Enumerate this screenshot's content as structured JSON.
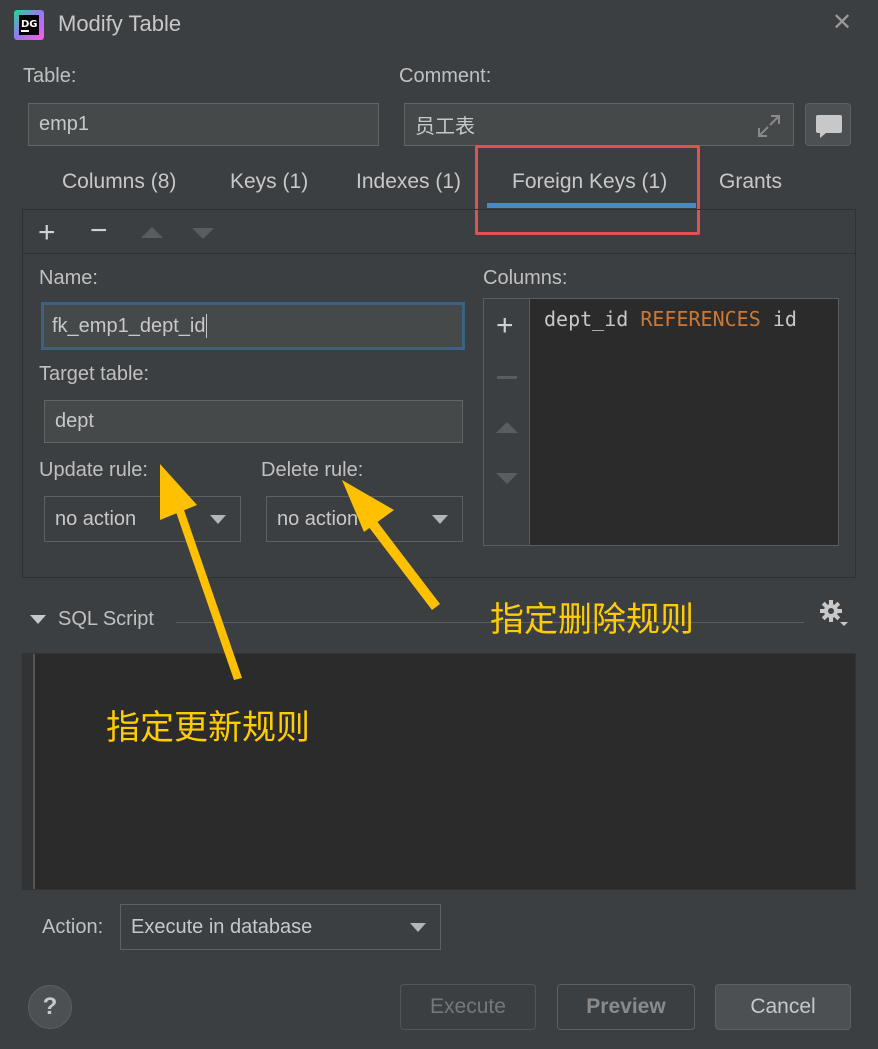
{
  "window": {
    "title": "Modify Table",
    "app_icon_text": "DG"
  },
  "table": {
    "label": "Table:",
    "value": "emp1"
  },
  "comment": {
    "label": "Comment:",
    "value": "员工表"
  },
  "tabs": [
    {
      "label": "Columns (8)"
    },
    {
      "label": "Keys (1)"
    },
    {
      "label": "Indexes (1)"
    },
    {
      "label": "Foreign Keys (1)",
      "selected": true
    },
    {
      "label": "Grants"
    }
  ],
  "toolbar": {
    "add": "+",
    "remove": "−"
  },
  "fk": {
    "name_label": "Name:",
    "name_value": "fk_emp1_dept_id",
    "target_label": "Target table:",
    "target_value": "dept",
    "update_label": "Update rule:",
    "update_value": "no action",
    "delete_label": "Delete rule:",
    "delete_value": "no action",
    "columns_label": "Columns:",
    "mapping": {
      "column": "dept_id",
      "keyword": "REFERENCES",
      "ref": "id"
    }
  },
  "sql": {
    "label": "SQL Script"
  },
  "action": {
    "label": "Action:",
    "value": "Execute in database"
  },
  "buttons": {
    "help": "?",
    "execute": "Execute",
    "preview": "Preview",
    "cancel": "Cancel"
  },
  "annotations": {
    "update": "指定更新规则",
    "delete": "指定删除规则"
  },
  "colors": {
    "accent": "#4a88c7",
    "highlight": "#e05252",
    "annotation": "#ffcc00",
    "keyword": "#cc7832"
  }
}
